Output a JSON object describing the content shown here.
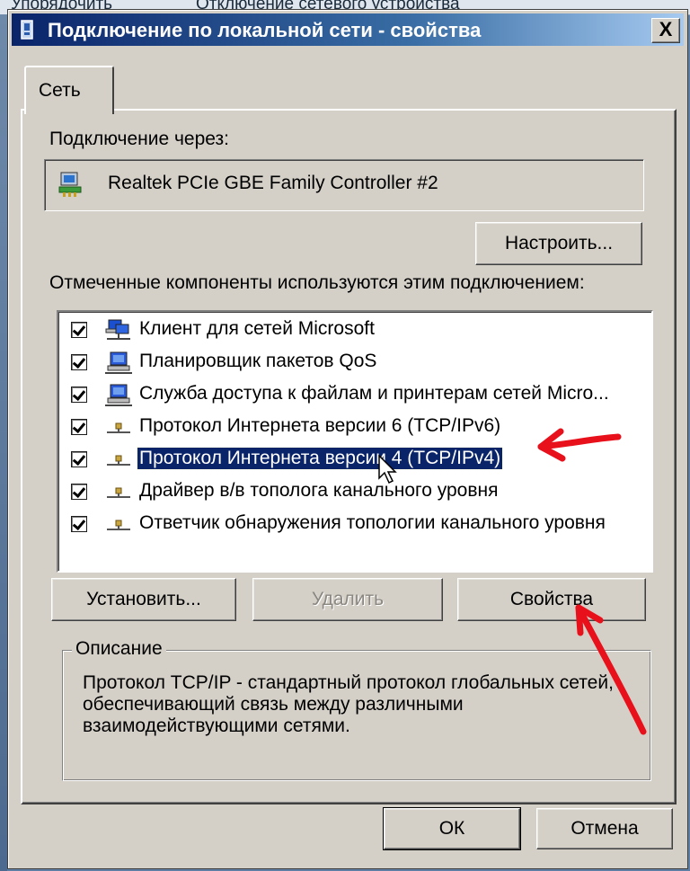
{
  "background": {
    "items": [
      "Упорядочить",
      "Отключение сетевого устройства"
    ]
  },
  "dialog": {
    "title": "Подключение по локальной сети - свойства",
    "close_label": "X",
    "tab_label": "Сеть",
    "connect_using_label": "Подключение через:",
    "adapter_name": "Realtek PCIe GBE Family Controller #2",
    "configure_button": "Настроить...",
    "components_label": "Отмеченные компоненты используются этим подключением:",
    "components": [
      {
        "label": "Клиент для сетей Microsoft",
        "checked": true,
        "icon": "network-client-icon"
      },
      {
        "label": "Планировщик пакетов QoS",
        "checked": true,
        "icon": "network-service-icon"
      },
      {
        "label": "Служба доступа к файлам и принтерам сетей Micro...",
        "checked": true,
        "icon": "network-service-icon"
      },
      {
        "label": "Протокол Интернета версии 6 (TCP/IPv6)",
        "checked": true,
        "icon": "protocol-icon"
      },
      {
        "label": "Протокол Интернета версии 4 (TCP/IPv4)",
        "checked": true,
        "icon": "protocol-icon",
        "selected": true
      },
      {
        "label": "Драйвер в/в тополога канального уровня",
        "checked": true,
        "icon": "protocol-icon"
      },
      {
        "label": "Ответчик обнаружения топологии канального уровня",
        "checked": true,
        "icon": "protocol-icon"
      }
    ],
    "install_button": "Установить...",
    "uninstall_button": "Удалить",
    "properties_button": "Свойства",
    "description_label": "Описание",
    "description_text": "Протокол TCP/IP - стандартный протокол глобальных сетей, обеспечивающий связь между различными взаимодействующими сетями.",
    "ok_button": "ОК",
    "cancel_button": "Отмена"
  },
  "colors": {
    "dialog_bg": "#d4d0c8",
    "title_start": "#0a246a",
    "title_end": "#a6caf0",
    "selection": "#0a246a",
    "annotation_arrow": "#e8101a"
  }
}
